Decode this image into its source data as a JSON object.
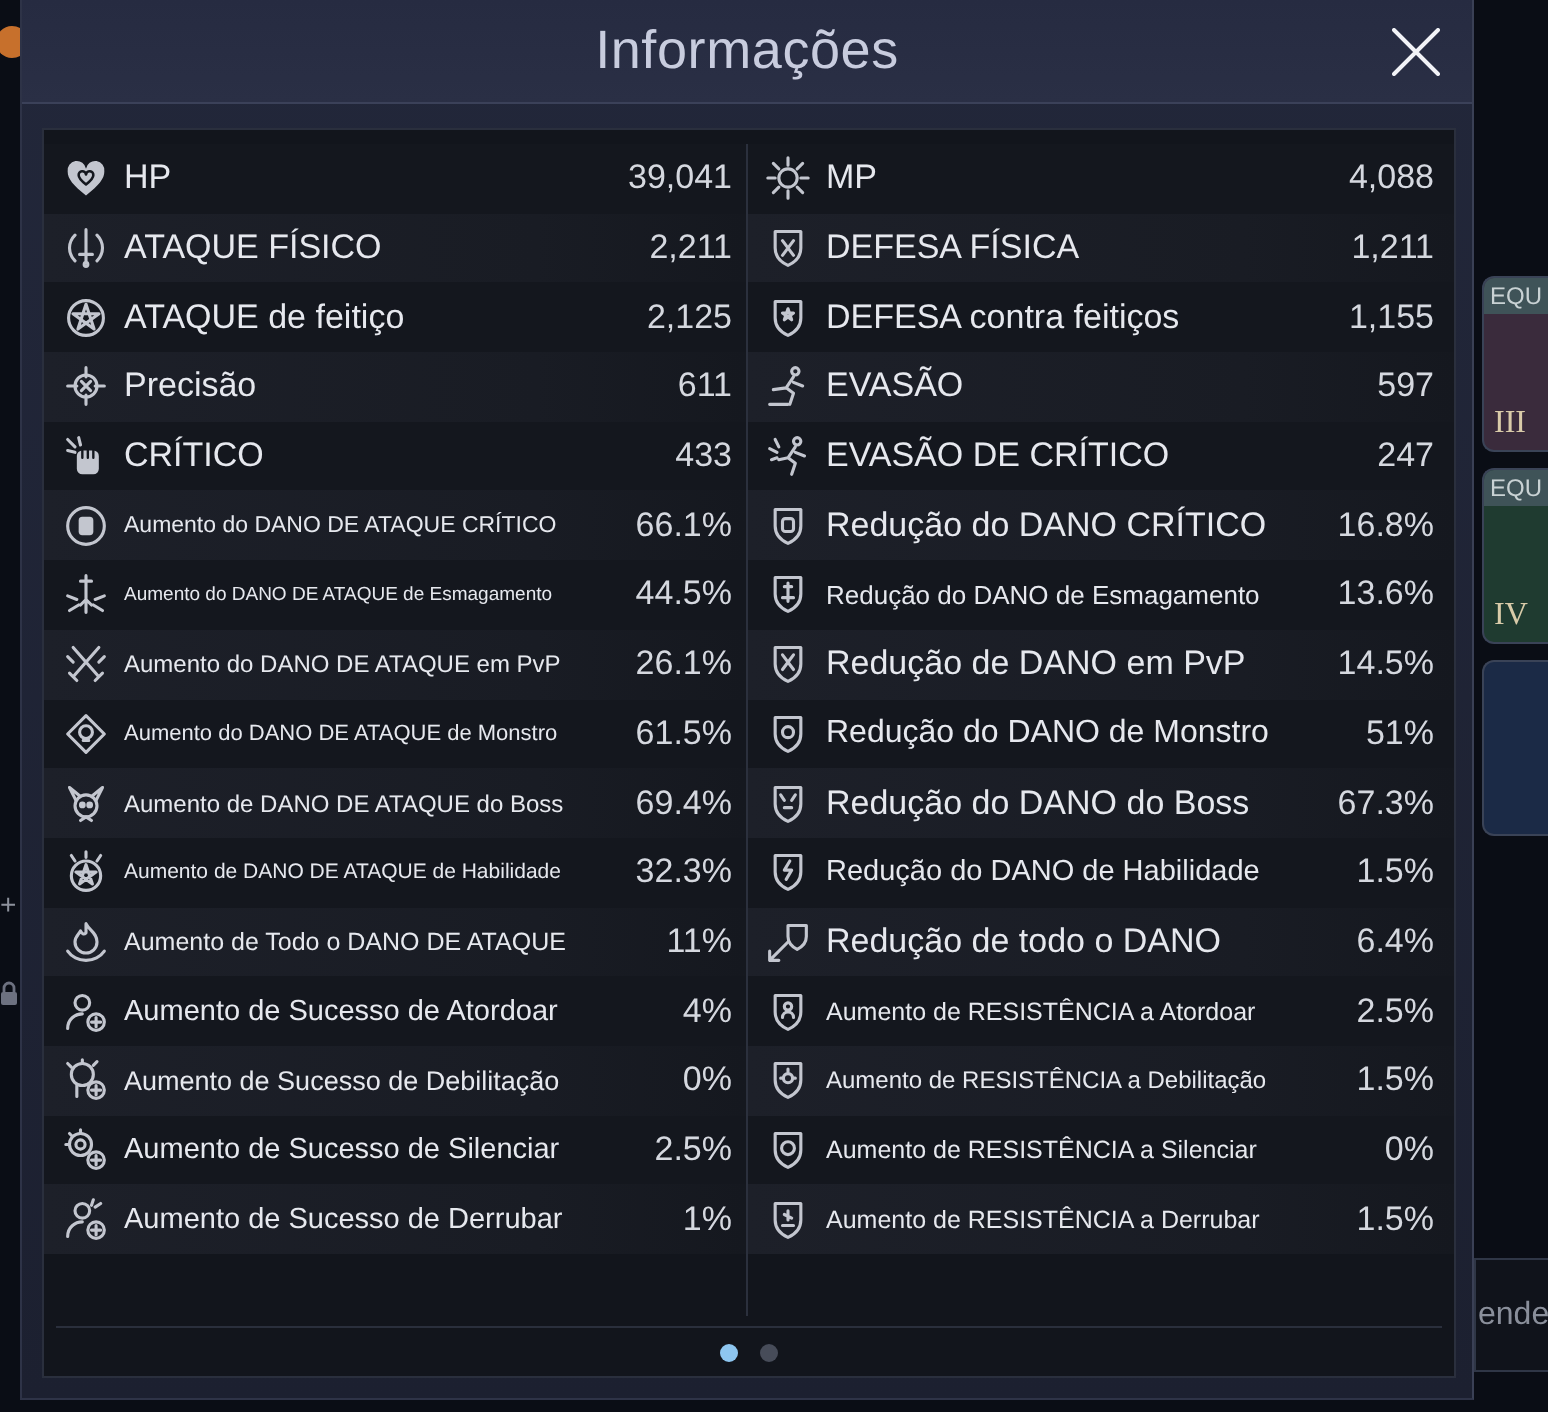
{
  "dialog": {
    "title": "Informações"
  },
  "stats": {
    "left": [
      {
        "label": "HP",
        "value": "39,041"
      },
      {
        "label": "ATAQUE FÍSICO",
        "value": "2,211"
      },
      {
        "label": "ATAQUE de feitiço",
        "value": "2,125"
      },
      {
        "label": "Precisão",
        "value": "611"
      },
      {
        "label": "CRÍTICO",
        "value": "433"
      },
      {
        "label": "Aumento do DANO DE ATAQUE CRÍTICO",
        "value": "66.1%"
      },
      {
        "label": "Aumento do DANO DE ATAQUE de Esmagamento",
        "value": "44.5%"
      },
      {
        "label": "Aumento do DANO DE ATAQUE em PvP",
        "value": "26.1%"
      },
      {
        "label": "Aumento do DANO DE ATAQUE de Monstro",
        "value": "61.5%"
      },
      {
        "label": "Aumento de DANO DE ATAQUE do Boss",
        "value": "69.4%"
      },
      {
        "label": "Aumento de DANO DE ATAQUE de Habilidade",
        "value": "32.3%"
      },
      {
        "label": "Aumento de Todo o DANO DE ATAQUE",
        "value": "11%"
      },
      {
        "label": "Aumento de Sucesso de Atordoar",
        "value": "4%"
      },
      {
        "label": "Aumento de Sucesso de Debilitação",
        "value": "0%"
      },
      {
        "label": "Aumento de Sucesso de Silenciar",
        "value": "2.5%"
      },
      {
        "label": "Aumento de Sucesso de Derrubar",
        "value": "1%"
      }
    ],
    "right": [
      {
        "label": "MP",
        "value": "4,088"
      },
      {
        "label": "DEFESA FÍSICA",
        "value": "1,211"
      },
      {
        "label": "DEFESA contra feitiços",
        "value": "1,155"
      },
      {
        "label": "EVASÃO",
        "value": "597"
      },
      {
        "label": "EVASÃO DE CRÍTICO",
        "value": "247"
      },
      {
        "label": "Redução do DANO CRÍTICO",
        "value": "16.8%"
      },
      {
        "label": "Redução do DANO de Esmagamento",
        "value": "13.6%"
      },
      {
        "label": "Redução de DANO em PvP",
        "value": "14.5%"
      },
      {
        "label": "Redução do DANO de Monstro",
        "value": "51%"
      },
      {
        "label": "Redução do DANO do Boss",
        "value": "67.3%"
      },
      {
        "label": "Redução do DANO de Habilidade",
        "value": "1.5%"
      },
      {
        "label": "Redução de todo o DANO",
        "value": "6.4%"
      },
      {
        "label": "Aumento de RESISTÊNCIA a Atordoar",
        "value": "2.5%"
      },
      {
        "label": "Aumento de RESISTÊNCIA a Debilitação",
        "value": "1.5%"
      },
      {
        "label": "Aumento de RESISTÊNCIA a Silenciar",
        "value": "0%"
      },
      {
        "label": "Aumento de RESISTÊNCIA a Derrubar",
        "value": "1.5%"
      }
    ]
  },
  "pagination": [
    {
      "selected": true
    },
    {
      "selected": false
    }
  ],
  "background": {
    "side_text": "+",
    "item_cards": [
      {
        "label": "EQU",
        "tier": "III",
        "color": "#3a2b3c"
      },
      {
        "label": "EQU",
        "tier": "IV",
        "color": "#1f3b30"
      },
      {
        "color": "#1b2a46"
      }
    ],
    "action_text": "ende"
  }
}
